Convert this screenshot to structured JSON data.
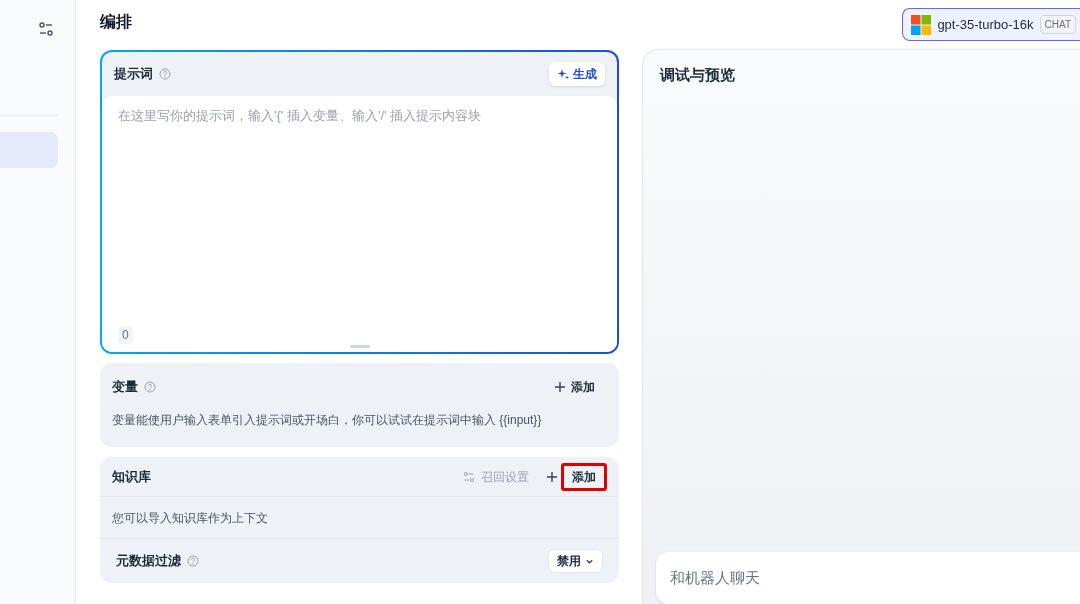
{
  "page_title": "编排",
  "model": {
    "name": "gpt-35-turbo-16k",
    "tag": "CHAT"
  },
  "prompt": {
    "title": "提示词",
    "generate_button": "生成",
    "placeholder": "在这里写你的提示词，输入'{' 插入变量、输入'/' 插入提示内容块",
    "count": "0"
  },
  "variables": {
    "title": "变量",
    "add_button": "添加",
    "description": "变量能使用户输入表单引入提示词或开场白，你可以试试在提示词中输入 {{input}}"
  },
  "knowledge": {
    "title": "知识库",
    "settings_button": "召回设置",
    "add_button": "添加",
    "add_highlighted": true,
    "description": "您可以导入知识库作为上下文",
    "filter_label": "元数据过滤",
    "filter_value": "禁用"
  },
  "preview": {
    "title": "调试与预览",
    "chat_placeholder": "和机器人聊天"
  }
}
